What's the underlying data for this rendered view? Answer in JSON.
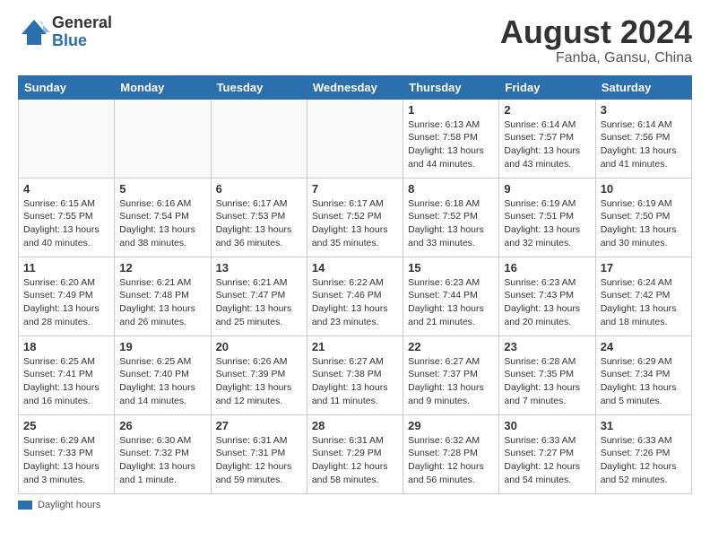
{
  "logo": {
    "general": "General",
    "blue": "Blue"
  },
  "title": "August 2024",
  "location": "Fanba, Gansu, China",
  "days_of_week": [
    "Sunday",
    "Monday",
    "Tuesday",
    "Wednesday",
    "Thursday",
    "Friday",
    "Saturday"
  ],
  "weeks": [
    [
      {
        "day": "",
        "info": ""
      },
      {
        "day": "",
        "info": ""
      },
      {
        "day": "",
        "info": ""
      },
      {
        "day": "",
        "info": ""
      },
      {
        "day": "1",
        "info": "Sunrise: 6:13 AM\nSunset: 7:58 PM\nDaylight: 13 hours and 44 minutes."
      },
      {
        "day": "2",
        "info": "Sunrise: 6:14 AM\nSunset: 7:57 PM\nDaylight: 13 hours and 43 minutes."
      },
      {
        "day": "3",
        "info": "Sunrise: 6:14 AM\nSunset: 7:56 PM\nDaylight: 13 hours and 41 minutes."
      }
    ],
    [
      {
        "day": "4",
        "info": "Sunrise: 6:15 AM\nSunset: 7:55 PM\nDaylight: 13 hours and 40 minutes."
      },
      {
        "day": "5",
        "info": "Sunrise: 6:16 AM\nSunset: 7:54 PM\nDaylight: 13 hours and 38 minutes."
      },
      {
        "day": "6",
        "info": "Sunrise: 6:17 AM\nSunset: 7:53 PM\nDaylight: 13 hours and 36 minutes."
      },
      {
        "day": "7",
        "info": "Sunrise: 6:17 AM\nSunset: 7:52 PM\nDaylight: 13 hours and 35 minutes."
      },
      {
        "day": "8",
        "info": "Sunrise: 6:18 AM\nSunset: 7:52 PM\nDaylight: 13 hours and 33 minutes."
      },
      {
        "day": "9",
        "info": "Sunrise: 6:19 AM\nSunset: 7:51 PM\nDaylight: 13 hours and 32 minutes."
      },
      {
        "day": "10",
        "info": "Sunrise: 6:19 AM\nSunset: 7:50 PM\nDaylight: 13 hours and 30 minutes."
      }
    ],
    [
      {
        "day": "11",
        "info": "Sunrise: 6:20 AM\nSunset: 7:49 PM\nDaylight: 13 hours and 28 minutes."
      },
      {
        "day": "12",
        "info": "Sunrise: 6:21 AM\nSunset: 7:48 PM\nDaylight: 13 hours and 26 minutes."
      },
      {
        "day": "13",
        "info": "Sunrise: 6:21 AM\nSunset: 7:47 PM\nDaylight: 13 hours and 25 minutes."
      },
      {
        "day": "14",
        "info": "Sunrise: 6:22 AM\nSunset: 7:46 PM\nDaylight: 13 hours and 23 minutes."
      },
      {
        "day": "15",
        "info": "Sunrise: 6:23 AM\nSunset: 7:44 PM\nDaylight: 13 hours and 21 minutes."
      },
      {
        "day": "16",
        "info": "Sunrise: 6:23 AM\nSunset: 7:43 PM\nDaylight: 13 hours and 20 minutes."
      },
      {
        "day": "17",
        "info": "Sunrise: 6:24 AM\nSunset: 7:42 PM\nDaylight: 13 hours and 18 minutes."
      }
    ],
    [
      {
        "day": "18",
        "info": "Sunrise: 6:25 AM\nSunset: 7:41 PM\nDaylight: 13 hours and 16 minutes."
      },
      {
        "day": "19",
        "info": "Sunrise: 6:25 AM\nSunset: 7:40 PM\nDaylight: 13 hours and 14 minutes."
      },
      {
        "day": "20",
        "info": "Sunrise: 6:26 AM\nSunset: 7:39 PM\nDaylight: 13 hours and 12 minutes."
      },
      {
        "day": "21",
        "info": "Sunrise: 6:27 AM\nSunset: 7:38 PM\nDaylight: 13 hours and 11 minutes."
      },
      {
        "day": "22",
        "info": "Sunrise: 6:27 AM\nSunset: 7:37 PM\nDaylight: 13 hours and 9 minutes."
      },
      {
        "day": "23",
        "info": "Sunrise: 6:28 AM\nSunset: 7:35 PM\nDaylight: 13 hours and 7 minutes."
      },
      {
        "day": "24",
        "info": "Sunrise: 6:29 AM\nSunset: 7:34 PM\nDaylight: 13 hours and 5 minutes."
      }
    ],
    [
      {
        "day": "25",
        "info": "Sunrise: 6:29 AM\nSunset: 7:33 PM\nDaylight: 13 hours and 3 minutes."
      },
      {
        "day": "26",
        "info": "Sunrise: 6:30 AM\nSunset: 7:32 PM\nDaylight: 13 hours and 1 minute."
      },
      {
        "day": "27",
        "info": "Sunrise: 6:31 AM\nSunset: 7:31 PM\nDaylight: 12 hours and 59 minutes."
      },
      {
        "day": "28",
        "info": "Sunrise: 6:31 AM\nSunset: 7:29 PM\nDaylight: 12 hours and 58 minutes."
      },
      {
        "day": "29",
        "info": "Sunrise: 6:32 AM\nSunset: 7:28 PM\nDaylight: 12 hours and 56 minutes."
      },
      {
        "day": "30",
        "info": "Sunrise: 6:33 AM\nSunset: 7:27 PM\nDaylight: 12 hours and 54 minutes."
      },
      {
        "day": "31",
        "info": "Sunrise: 6:33 AM\nSunset: 7:26 PM\nDaylight: 12 hours and 52 minutes."
      }
    ]
  ],
  "footer": {
    "label": "Daylight hours"
  }
}
